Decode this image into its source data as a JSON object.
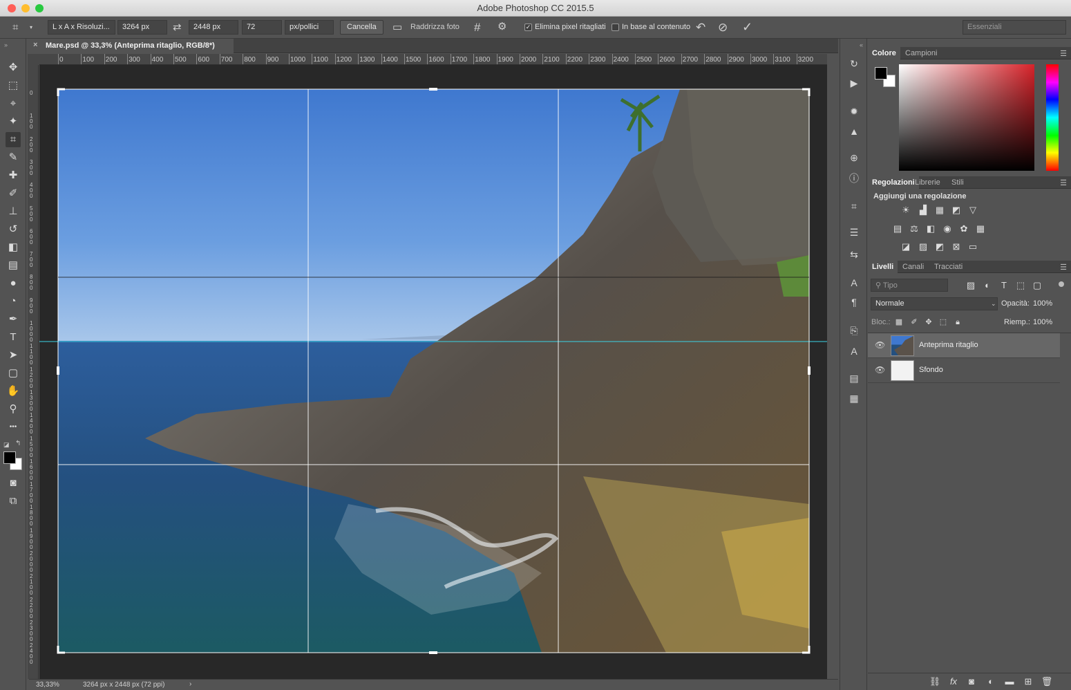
{
  "window": {
    "title": "Adobe Photoshop CC 2015.5"
  },
  "options_bar": {
    "ratio_preset": "L x A x Risoluzi...",
    "width": "3264 px",
    "height": "2448 px",
    "resolution": "72",
    "resolution_unit": "px/pollici",
    "clear_label": "Cancella",
    "straighten_label": "Raddrizza foto",
    "delete_cropped_label": "Elimina pixel ritagliati",
    "delete_cropped_checked": true,
    "content_aware_label": "In base al contenuto",
    "content_aware_checked": false,
    "workspace": "Essenziali"
  },
  "document": {
    "tab_title": "Mare.psd @ 33,3% (Anteprima ritaglio, RGB/8*)",
    "close_glyph": "×",
    "zoom": "33,33%",
    "info": "3264 px x 2448 px (72 ppi)",
    "info_arrow": "›"
  },
  "ruler": {
    "h_ticks": [
      "0",
      "100",
      "200",
      "300",
      "400",
      "500",
      "600",
      "700",
      "800",
      "900",
      "1000",
      "1100",
      "1200",
      "1300",
      "1400",
      "1500",
      "1600",
      "1700",
      "1800",
      "1900",
      "2000",
      "2100",
      "2200",
      "2300",
      "2400",
      "2500",
      "2600",
      "2700",
      "2800",
      "2900",
      "3000",
      "3100",
      "3200"
    ],
    "v_ticks": [
      "0",
      "100",
      "200",
      "300",
      "400",
      "500",
      "600",
      "700",
      "800",
      "900",
      "1000",
      "1100",
      "1200",
      "1300",
      "1400",
      "1500",
      "1600",
      "1700",
      "1800",
      "1900",
      "2000",
      "2100",
      "2200",
      "2300",
      "2400"
    ]
  },
  "tools": [
    {
      "name": "move-tool",
      "glyph": "✥"
    },
    {
      "name": "marquee-tool",
      "glyph": "⬚"
    },
    {
      "name": "lasso-tool",
      "glyph": "⌖"
    },
    {
      "name": "magic-wand-tool",
      "glyph": "✦"
    },
    {
      "name": "crop-tool",
      "glyph": "⌗"
    },
    {
      "name": "eyedropper-tool",
      "glyph": "✎"
    },
    {
      "name": "healing-brush-tool",
      "glyph": "✚"
    },
    {
      "name": "brush-tool",
      "glyph": "✐"
    },
    {
      "name": "clone-stamp-tool",
      "glyph": "⊥"
    },
    {
      "name": "history-brush-tool",
      "glyph": "↺"
    },
    {
      "name": "eraser-tool",
      "glyph": "◧"
    },
    {
      "name": "gradient-tool",
      "glyph": "▤"
    },
    {
      "name": "blur-tool",
      "glyph": "●"
    },
    {
      "name": "dodge-tool",
      "glyph": "◔"
    },
    {
      "name": "pen-tool",
      "glyph": "✒"
    },
    {
      "name": "type-tool",
      "glyph": "T"
    },
    {
      "name": "path-selection-tool",
      "glyph": "➤"
    },
    {
      "name": "shape-tool",
      "glyph": "▢"
    },
    {
      "name": "hand-tool",
      "glyph": "✋"
    },
    {
      "name": "zoom-tool",
      "glyph": "⚲"
    },
    {
      "name": "more-tools",
      "glyph": "•••"
    }
  ],
  "right_strip_icons": [
    "history-icon",
    "actions-icon",
    "brush-settings-icon",
    "brushes-icon",
    "clone-source-icon",
    "info-icon",
    "tool-presets-icon",
    "properties-icon",
    "adjust-icon",
    "character-icon",
    "paragraph-icon",
    "character-styles-icon",
    "paragraph-styles-icon",
    "notes-icon",
    "timeline-icon"
  ],
  "color_panel": {
    "tabs": [
      "Colore",
      "Campioni"
    ],
    "foreground": "#000000",
    "background": "#ffffff",
    "hue_color": "#d8232a"
  },
  "adjustments_panel": {
    "tabs": [
      "Regolazioni",
      "Librerie",
      "Stili"
    ],
    "heading": "Aggiungi una regolazione"
  },
  "layers_panel": {
    "tabs": [
      "Livelli",
      "Canali",
      "Tracciati"
    ],
    "search_placeholder": "Tipo",
    "blend_mode": "Normale",
    "opacity_label": "Opacità:",
    "opacity_value": "100%",
    "lock_label": "Bloc.:",
    "fill_label": "Riemp.:",
    "fill_value": "100%",
    "layers": [
      {
        "name": "Anteprima ritaglio",
        "selected": true
      },
      {
        "name": "Sfondo",
        "selected": false
      }
    ]
  },
  "colors": {
    "accent": "#4a90e2",
    "selected_layer": "#676767",
    "guide": "#3ad3e6"
  }
}
